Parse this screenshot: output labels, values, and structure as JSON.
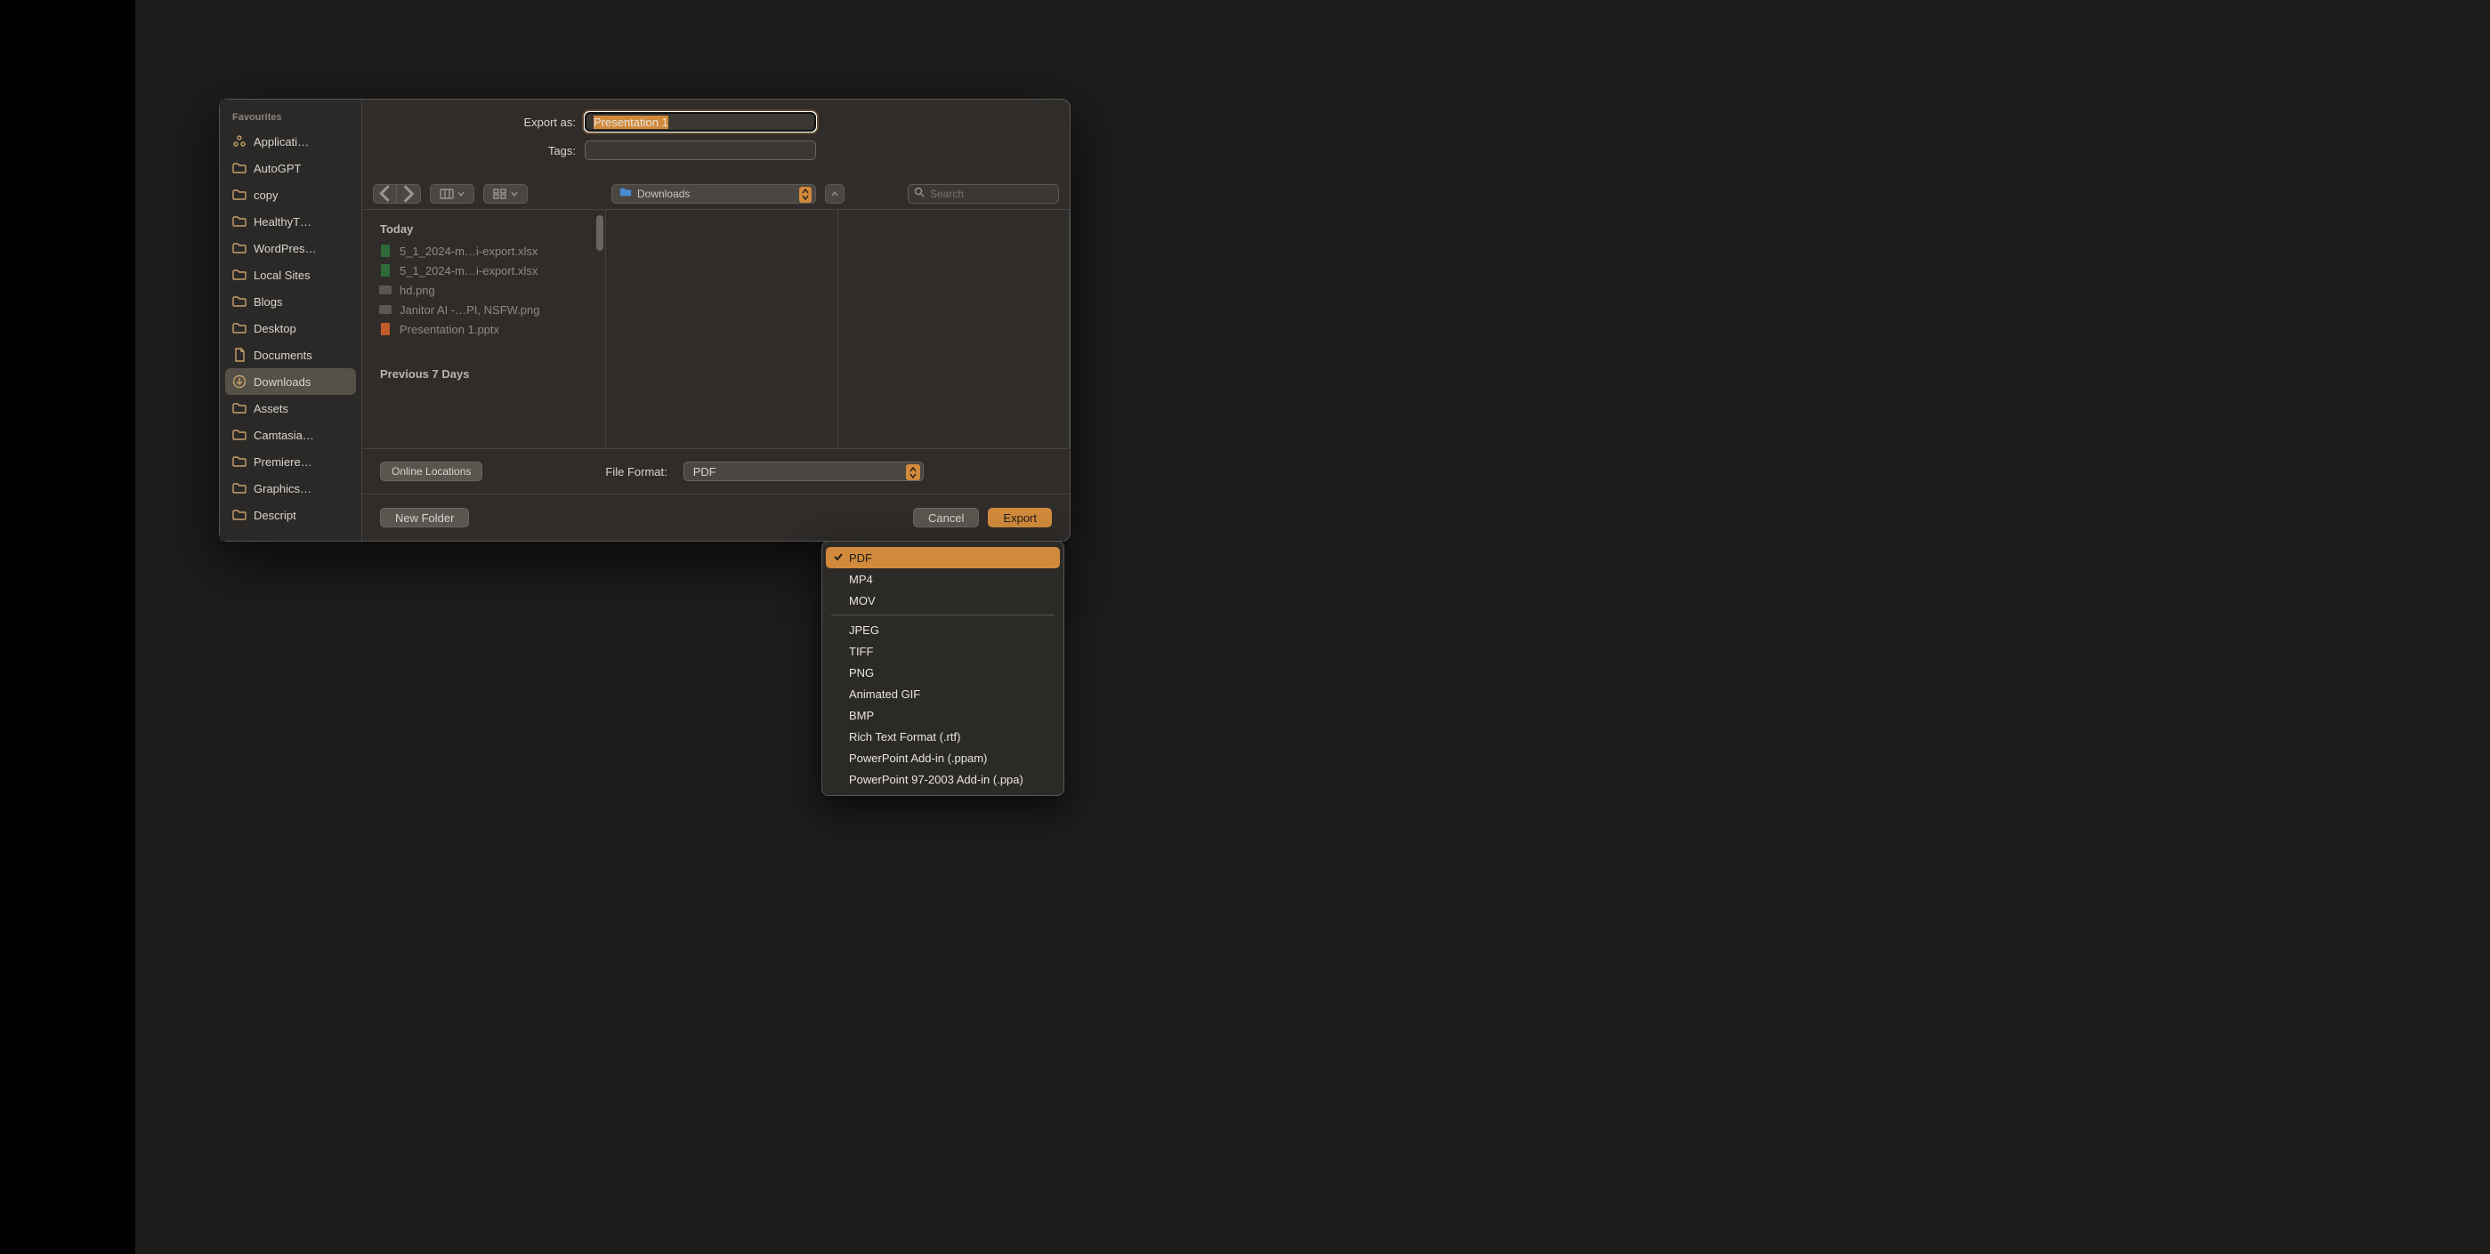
{
  "sidebar": {
    "header": "Favourites",
    "items": [
      {
        "label": "Applicati…"
      },
      {
        "label": "AutoGPT"
      },
      {
        "label": "copy"
      },
      {
        "label": "HealthyT…"
      },
      {
        "label": "WordPres…"
      },
      {
        "label": "Local Sites"
      },
      {
        "label": "Blogs"
      },
      {
        "label": "Desktop"
      },
      {
        "label": "Documents"
      },
      {
        "label": "Downloads"
      },
      {
        "label": "Assets"
      },
      {
        "label": "Camtasia…"
      },
      {
        "label": "Premiere…"
      },
      {
        "label": "Graphics…"
      },
      {
        "label": "Descript"
      }
    ],
    "active_index": 9
  },
  "form": {
    "export_as_label": "Export as:",
    "export_as_value": "Presentation 1",
    "tags_label": "Tags:",
    "tags_value": ""
  },
  "toolbar": {
    "location": "Downloads",
    "search_placeholder": "Search"
  },
  "filelist": {
    "group_today": "Today",
    "today": [
      {
        "icon": "xls",
        "name": "5_1_2024-m…i-export.xlsx"
      },
      {
        "icon": "xls",
        "name": "5_1_2024-m…i-export.xlsx"
      },
      {
        "icon": "img",
        "name": "hd.png"
      },
      {
        "icon": "img",
        "name": "Janitor AI -…PI, NSFW.png"
      },
      {
        "icon": "ppt",
        "name": "Presentation 1.pptx"
      }
    ],
    "group_prev7": "Previous 7 Days"
  },
  "format_bar": {
    "online_locations": "Online Locations",
    "file_format_label": "File Format:",
    "selected": "PDF"
  },
  "dropdown": {
    "items": [
      "PDF",
      "MP4",
      "MOV",
      "JPEG",
      "TIFF",
      "PNG",
      "Animated GIF",
      "BMP",
      "Rich Text Format (.rtf)",
      "PowerPoint Add-in (.ppam)",
      "PowerPoint 97-2003 Add-in (.ppa)"
    ],
    "selected_index": 0,
    "separator_after_index": 2
  },
  "bottom": {
    "new_folder": "New Folder",
    "cancel": "Cancel",
    "export": "Export"
  }
}
